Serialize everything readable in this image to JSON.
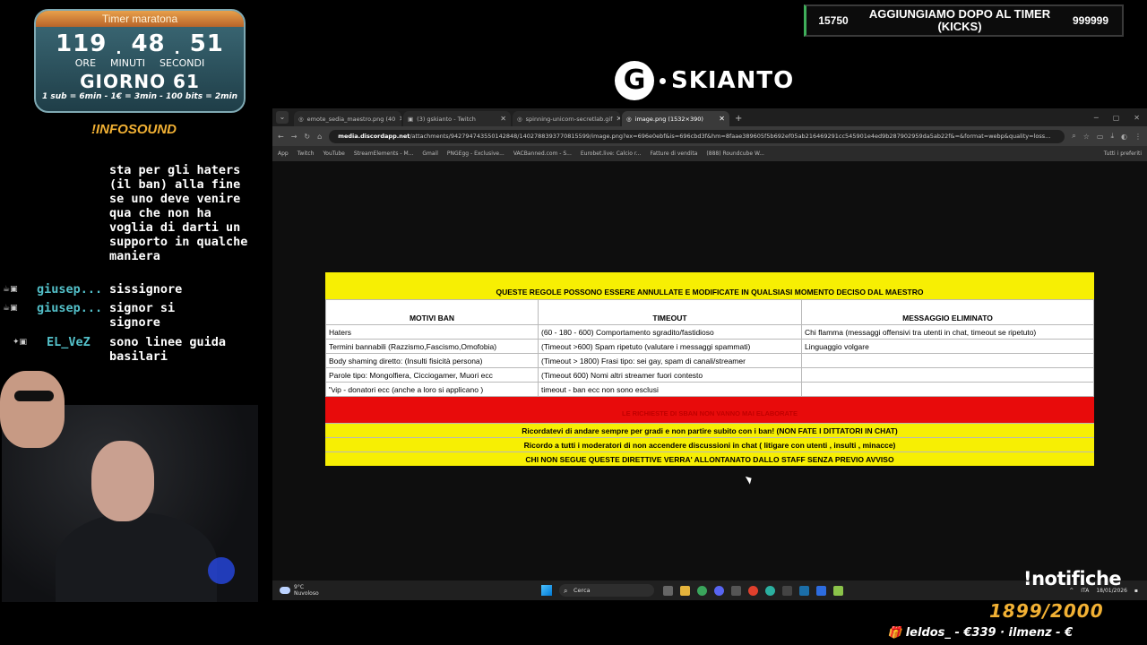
{
  "timer": {
    "title": "Timer maratona",
    "hours": "119",
    "minutes": "48",
    "seconds": "51",
    "label_hours": "ORE",
    "label_minutes": "MINUTI",
    "label_seconds": "SECONDI",
    "day": "GIORNO 61",
    "rates": "1 sub = 6min - 1€ = 3min - 100 bits = 2min"
  },
  "infosound": "!INFOSOUND",
  "chat": {
    "message_0": "sta per gli haters (il ban) alla fine se uno deve venire qua che non ha voglia di darti un supporto in qualche maniera",
    "messages": [
      {
        "user": "giusep...",
        "text": "sissignore"
      },
      {
        "user": "giusep...",
        "text": "signor si signore"
      },
      {
        "user": "EL_VeZ",
        "text": "sono linee guida basilari"
      }
    ]
  },
  "banner": {
    "left": "15750",
    "title": "AGGIUNGIAMO DOPO AL TIMER (KICKS)",
    "right": "999999"
  },
  "logo": {
    "letter": "G",
    "name": "SKIANTO"
  },
  "browser": {
    "tabs": [
      {
        "label": "emote_sedia_maestro.png (40"
      },
      {
        "label": "(3) gskianto - Twitch"
      },
      {
        "label": "spinning-unicorn-secretlab.gif"
      },
      {
        "label": "image.png (1532×390)"
      }
    ],
    "url_host": "media.discordapp.net",
    "url_path": "/attachments/942794743550142848/1402788393770815599/image.png?ex=696e0ebf&is=696cbd3f&hm=8faae389605f5b692ef05ab216469291cc545901e4ed9b287902959da5ab22f&=&format=webp&quality=loss...",
    "bookmarks": [
      "App",
      "Twitch",
      "YouTube",
      "StreamElements - M...",
      "Gmail",
      "PNGEgg - Exclusive...",
      "VACBanned.com - S...",
      "Eurobet.live: Calcio r...",
      "Fatture di vendita",
      "(888) Roundcube W..."
    ],
    "bookmarks_right": "Tutti i preferiti"
  },
  "rules": {
    "header": "QUESTE REGOLE POSSONO ESSERE ANNULLATE E MODIFICATE IN QUALSIASI MOMENTO DECISO DAL MAESTRO",
    "columns": [
      "MOTIVI BAN",
      "TIMEOUT",
      "MESSAGGIO ELIMINATO"
    ],
    "rows": [
      [
        "Haters",
        "(60 - 180 - 600) Comportamento sgradito/fastidioso",
        "Chi flamma (messaggi offensivi tra utenti in chat, timeout se ripetuto)"
      ],
      [
        "Termini bannabili (Razzismo,Fascismo,Omofobia)",
        "(Timeout >600) Spam ripetuto (valutare i messaggi spammati)",
        "Linguaggio volgare"
      ],
      [
        "Body shaming diretto: (Insulti fisicità persona)",
        "(Timeout > 1800) Frasi tipo: sei gay, spam di canali/streamer",
        ""
      ],
      [
        "Parole tipo: Mongolfiera, Cicciogamer, Muori ecc",
        "(Timeout 600) Nomi altri streamer fuori contesto",
        ""
      ],
      [
        "\"vip - donatori ecc (anche a loro si applicano )",
        "timeout - ban ecc non sono esclusi",
        ""
      ]
    ],
    "red_note": "LE RICHIESTE DI SBAN NON VANNO MAI ELABORATE",
    "notes": [
      "Ricordatevi di andare sempre per gradi e non partire subito con i ban! (NON FATE I DITTATORI IN CHAT)",
      "Ricordo a tutti i moderatori di non accendere discussioni in chat ( litigare con utenti , insulti , minacce)",
      "CHI NON SEGUE QUESTE DIRETTIVE VERRA' ALLONTANATO DALLO STAFF SENZA PREVIO AVVISO"
    ]
  },
  "taskbar": {
    "weather_temp": "9°C",
    "weather_desc": "Nuvoloso",
    "search": "Cerca",
    "lang": "ITA",
    "date": "18/01/2026"
  },
  "overlay": {
    "notifiche": "!notifiche",
    "counter": "1899/2000",
    "ticker": "leldos_ - €339 · ilmenz - €"
  }
}
